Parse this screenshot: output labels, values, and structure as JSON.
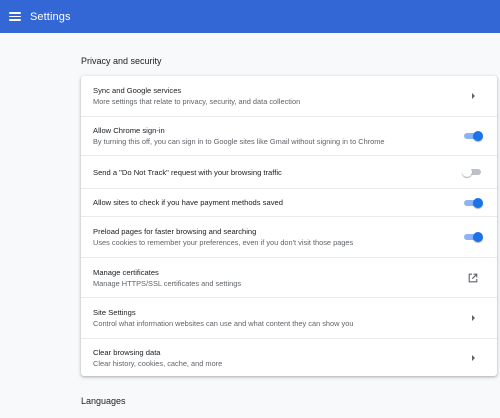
{
  "app": {
    "title": "Settings"
  },
  "sections": {
    "privacy": {
      "title": "Privacy and security"
    },
    "languages": {
      "title": "Languages"
    }
  },
  "rows": [
    {
      "label": "Sync and Google services",
      "sub": "More settings that relate to privacy, security, and data collection",
      "control": "chevron-right-icon"
    },
    {
      "label": "Allow Chrome sign-in",
      "sub": "By turning this off, you can sign in to Google sites like Gmail without signing in to Chrome",
      "control": "toggle",
      "state": "on"
    },
    {
      "label": "Send a \"Do Not Track\" request with your browsing traffic",
      "control": "toggle",
      "state": "off"
    },
    {
      "label": "Allow sites to check if you have payment methods saved",
      "control": "toggle",
      "state": "on"
    },
    {
      "label": "Preload pages for faster browsing and searching",
      "sub": "Uses cookies to remember your preferences, even if you don't visit those pages",
      "control": "toggle",
      "state": "on"
    },
    {
      "label": "Manage certificates",
      "sub": "Manage HTTPS/SSL certificates and settings",
      "control": "open-in-new-icon"
    },
    {
      "label": "Site Settings",
      "sub": "Control what information websites can use and what content they can show you",
      "control": "chevron-right-icon"
    },
    {
      "label": "Clear browsing data",
      "sub": "Clear history, cookies, cache, and more",
      "control": "chevron-right-icon"
    }
  ],
  "colors": {
    "header": "#3367d6",
    "toggle_on": "#1a73e8",
    "toggle_on_track": "#8ab4f8",
    "toggle_off_track": "#bdc1c6",
    "background": "#f8f9fa"
  }
}
